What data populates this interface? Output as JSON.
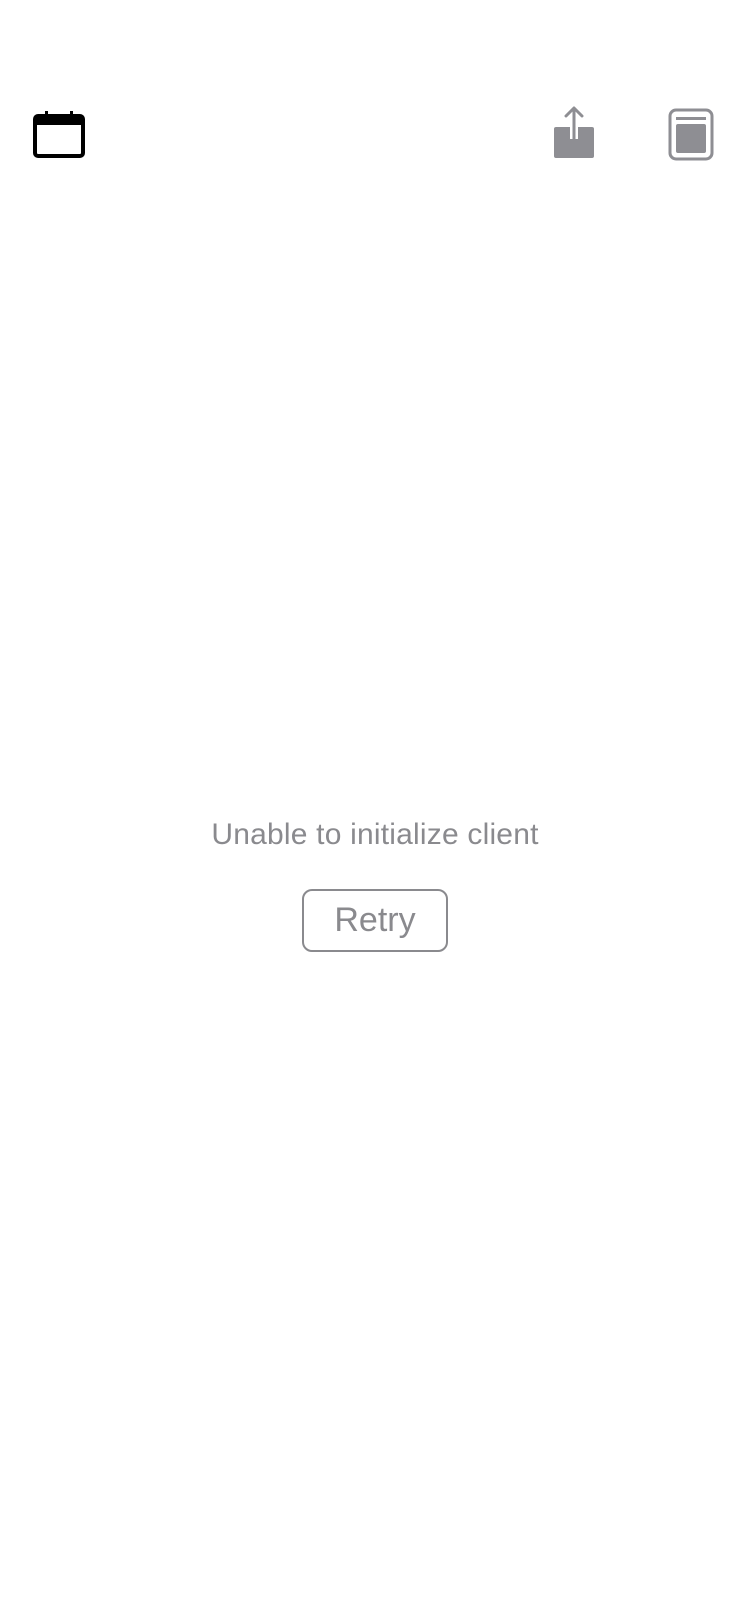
{
  "toolbar": {
    "left_icon": "calendar-icon",
    "right_icons": [
      "share-icon",
      "tabs-icon"
    ],
    "icon_color_active": "#000000",
    "icon_color_muted": "#8e8e93"
  },
  "content": {
    "error_message": "Unable to initialize client",
    "retry_label": "Retry",
    "text_color": "#8a8a8e"
  }
}
